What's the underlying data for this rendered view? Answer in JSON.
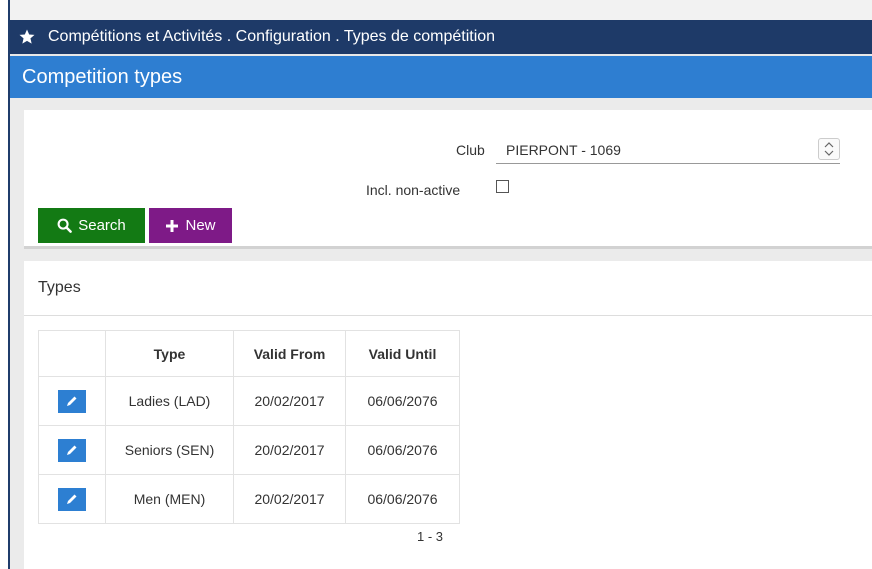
{
  "window": {
    "breadcrumb": "Compétitions et Activités . Configuration . Types de compétition"
  },
  "header": {
    "title": "Competition types"
  },
  "filters": {
    "club_label": "Club",
    "club_value": "PIERPONT - 1069",
    "inactive_label": "Incl. non-active",
    "inactive_checked": false
  },
  "buttons": {
    "search": "Search",
    "new": "New"
  },
  "types": {
    "title": "Types",
    "columns": [
      "",
      "Type",
      "Valid From",
      "Valid Until"
    ],
    "rows": [
      {
        "type": "Ladies (LAD)",
        "from": "20/02/2017",
        "until": "06/06/2076"
      },
      {
        "type": "Seniors (SEN)",
        "from": "20/02/2017",
        "until": "06/06/2076"
      },
      {
        "type": "Men (MEN)",
        "from": "20/02/2017",
        "until": "06/06/2076"
      }
    ],
    "pager": "1 - 3"
  },
  "colors": {
    "titlebar": "#1e3a68",
    "header": "#2e7ed1",
    "search_button": "#137a14",
    "new_button": "#7e1a87",
    "edit_button": "#2d7fd2"
  },
  "icons": {
    "title": "star-icon",
    "search": "search-icon",
    "new": "plus-icon",
    "edit": "pencil-icon",
    "select": "up-down-arrows-icon"
  }
}
